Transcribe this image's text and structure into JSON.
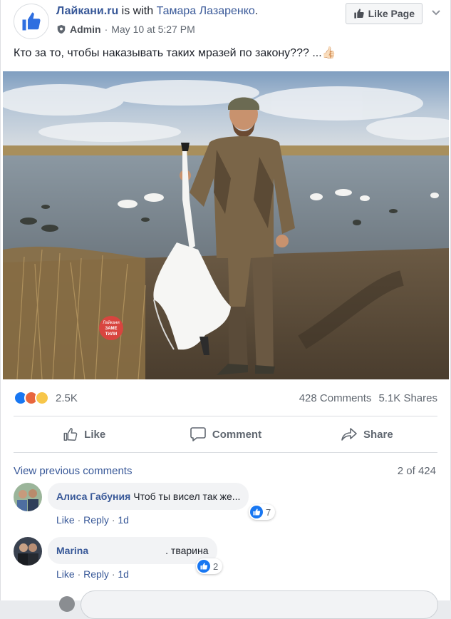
{
  "post": {
    "page_name": "Лайкани.ru",
    "with_text": " is with ",
    "tagged_person": "Тамара Лазаренко",
    "period": ".",
    "role": "Admin",
    "separator": "·",
    "timestamp": "May 10 at 5:27 PM",
    "like_page_label": "Like Page",
    "text": "Кто за то, чтобы наказывать таких мразей по закону??? ...👍🏻"
  },
  "photo": {
    "sticker_lines": [
      "Лайкани",
      "ЗАМЕ",
      "ТИЛИ"
    ]
  },
  "stats": {
    "reaction_count": "2.5K",
    "comments": "428 Comments",
    "shares": "5.1K Shares"
  },
  "actions": {
    "like": "Like",
    "comment": "Comment",
    "share": "Share"
  },
  "comments_section": {
    "view_previous": "View previous comments",
    "count": "2 of 424",
    "items": [
      {
        "author": "Алиса Габуния",
        "text": "Чтоб ты висел так же...",
        "reactions": "7",
        "like": "Like",
        "reply": "Reply",
        "age": "1d",
        "dot": "·"
      },
      {
        "author": "Marina",
        "text": ". тварина",
        "reactions": "2",
        "like": "Like",
        "reply": "Reply",
        "age": "1d",
        "dot": "·"
      }
    ]
  },
  "colors": {
    "link": "#385898",
    "brand_blue": "#1877f2",
    "muted": "#606770"
  },
  "icons": {
    "page_logo": "thumbs-up-icon",
    "admin": "shield-icon",
    "chevron": "chevron-down-icon",
    "like_action": "thumbs-up-outline-icon",
    "comment_action": "speech-bubble-icon",
    "share_action": "share-arrow-icon",
    "reactions": [
      "like-reaction-icon",
      "angry-reaction-icon",
      "sad-reaction-icon"
    ]
  }
}
